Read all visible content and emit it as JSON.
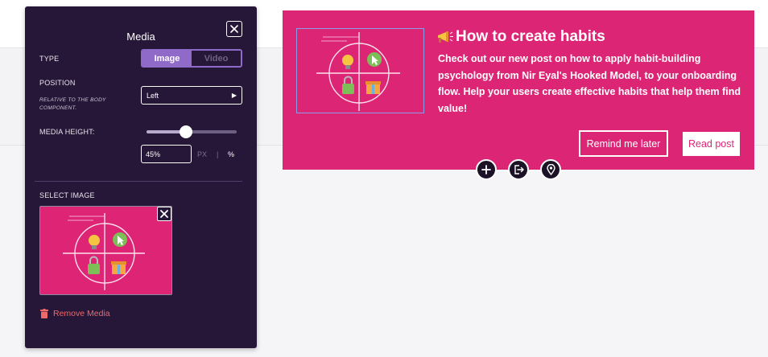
{
  "panel": {
    "title": "Media",
    "close_icon": "close-icon",
    "type": {
      "label": "TYPE",
      "options": [
        "Image",
        "Video"
      ],
      "selected": "Image"
    },
    "position": {
      "label": "POSITION",
      "sublabel": "RELATIVE TO THE BODY COMPONENT.",
      "value": "Left",
      "arrow_icon": "caret-right-icon"
    },
    "media_height": {
      "label": "MEDIA HEIGHT:",
      "value": "45%",
      "slider_fraction": 0.45,
      "unit_px": "PX",
      "unit_sep": "|",
      "unit_pct": "%"
    },
    "select_image": {
      "label": "SELECT IMAGE",
      "remove_icon": "close-icon"
    },
    "remove_media": {
      "label": "Remove Media",
      "icon": "trash-icon",
      "color": "#ee6a6a"
    }
  },
  "card": {
    "title": "How to create habits",
    "title_icon": "megaphone-icon",
    "body": "Check out our new post on how to apply habit-building psychology from Nir Eyal's Hooked Model, to your onboarding flow. Help your users create effective habits that help them find value!",
    "remind_label": "Remind me later",
    "read_label": "Read post",
    "color": "#dd2575"
  },
  "floating_actions": [
    {
      "icon": "plus-icon"
    },
    {
      "icon": "exit-icon"
    },
    {
      "icon": "location-pin-icon"
    }
  ],
  "colors": {
    "panel_bg": "#261638",
    "accent": "#8f6ac8",
    "brand_pink": "#dd2575"
  }
}
